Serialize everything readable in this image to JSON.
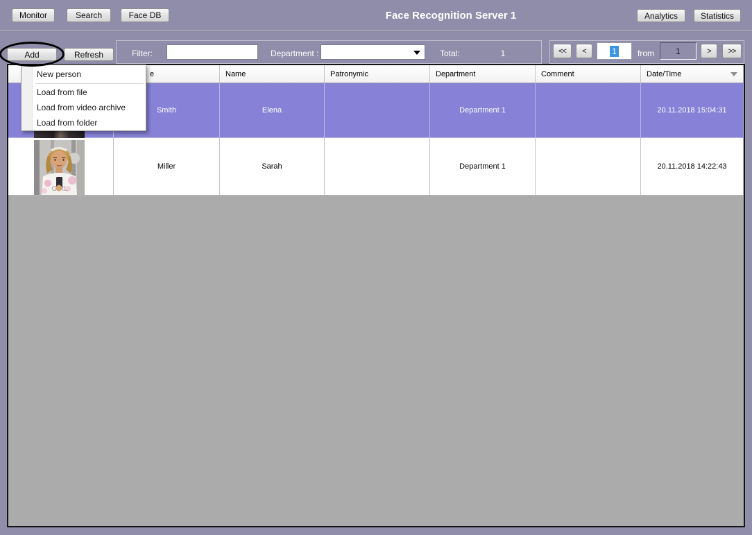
{
  "window": {
    "title": "Face Recognition Server 1"
  },
  "nav": {
    "monitor": "Monitor",
    "search": "Search",
    "face_db": "Face DB",
    "analytics": "Analytics",
    "statistics": "Statistics"
  },
  "toolbar": {
    "add_label": "Add",
    "refresh_label": "Refresh",
    "filter_label": "Filter:",
    "filter_value": "",
    "department_label": "Department :",
    "department_value": "",
    "total_label": "Total:",
    "total_value": "1",
    "pagination": {
      "first": "<<",
      "prev": "<",
      "page": "1",
      "from_label": "from",
      "total_pages": "1",
      "next": ">",
      "last": ">>"
    }
  },
  "annotation": {
    "type": "ellipse-highlight",
    "color": "#000000",
    "target": "add-button"
  },
  "add_menu": {
    "items": [
      "New person",
      "Load from file",
      "Load from video archive",
      "Load from folder"
    ]
  },
  "table": {
    "columns": [
      "",
      "e",
      "Name",
      "Patronymic",
      "Department",
      "Comment",
      "Date/Time"
    ],
    "rows": [
      {
        "surname": "Smith",
        "name": "Elena",
        "patronymic": "",
        "department": "Department 1",
        "comment": "",
        "datetime": "20.11.2018 15:04:31",
        "selected": true
      },
      {
        "surname": "Miller",
        "name": "Sarah",
        "patronymic": "",
        "department": "Department 1",
        "comment": "",
        "datetime": "20.11.2018 14:22:43",
        "selected": false,
        "photo": {
          "shirt_text": "GIRL"
        }
      }
    ]
  },
  "colors": {
    "background": "#8f8da9",
    "selected_row": "#8782d7",
    "table_empty_area": "#ababab",
    "text_selection": "#3b95e0",
    "annotation": "#000000"
  }
}
